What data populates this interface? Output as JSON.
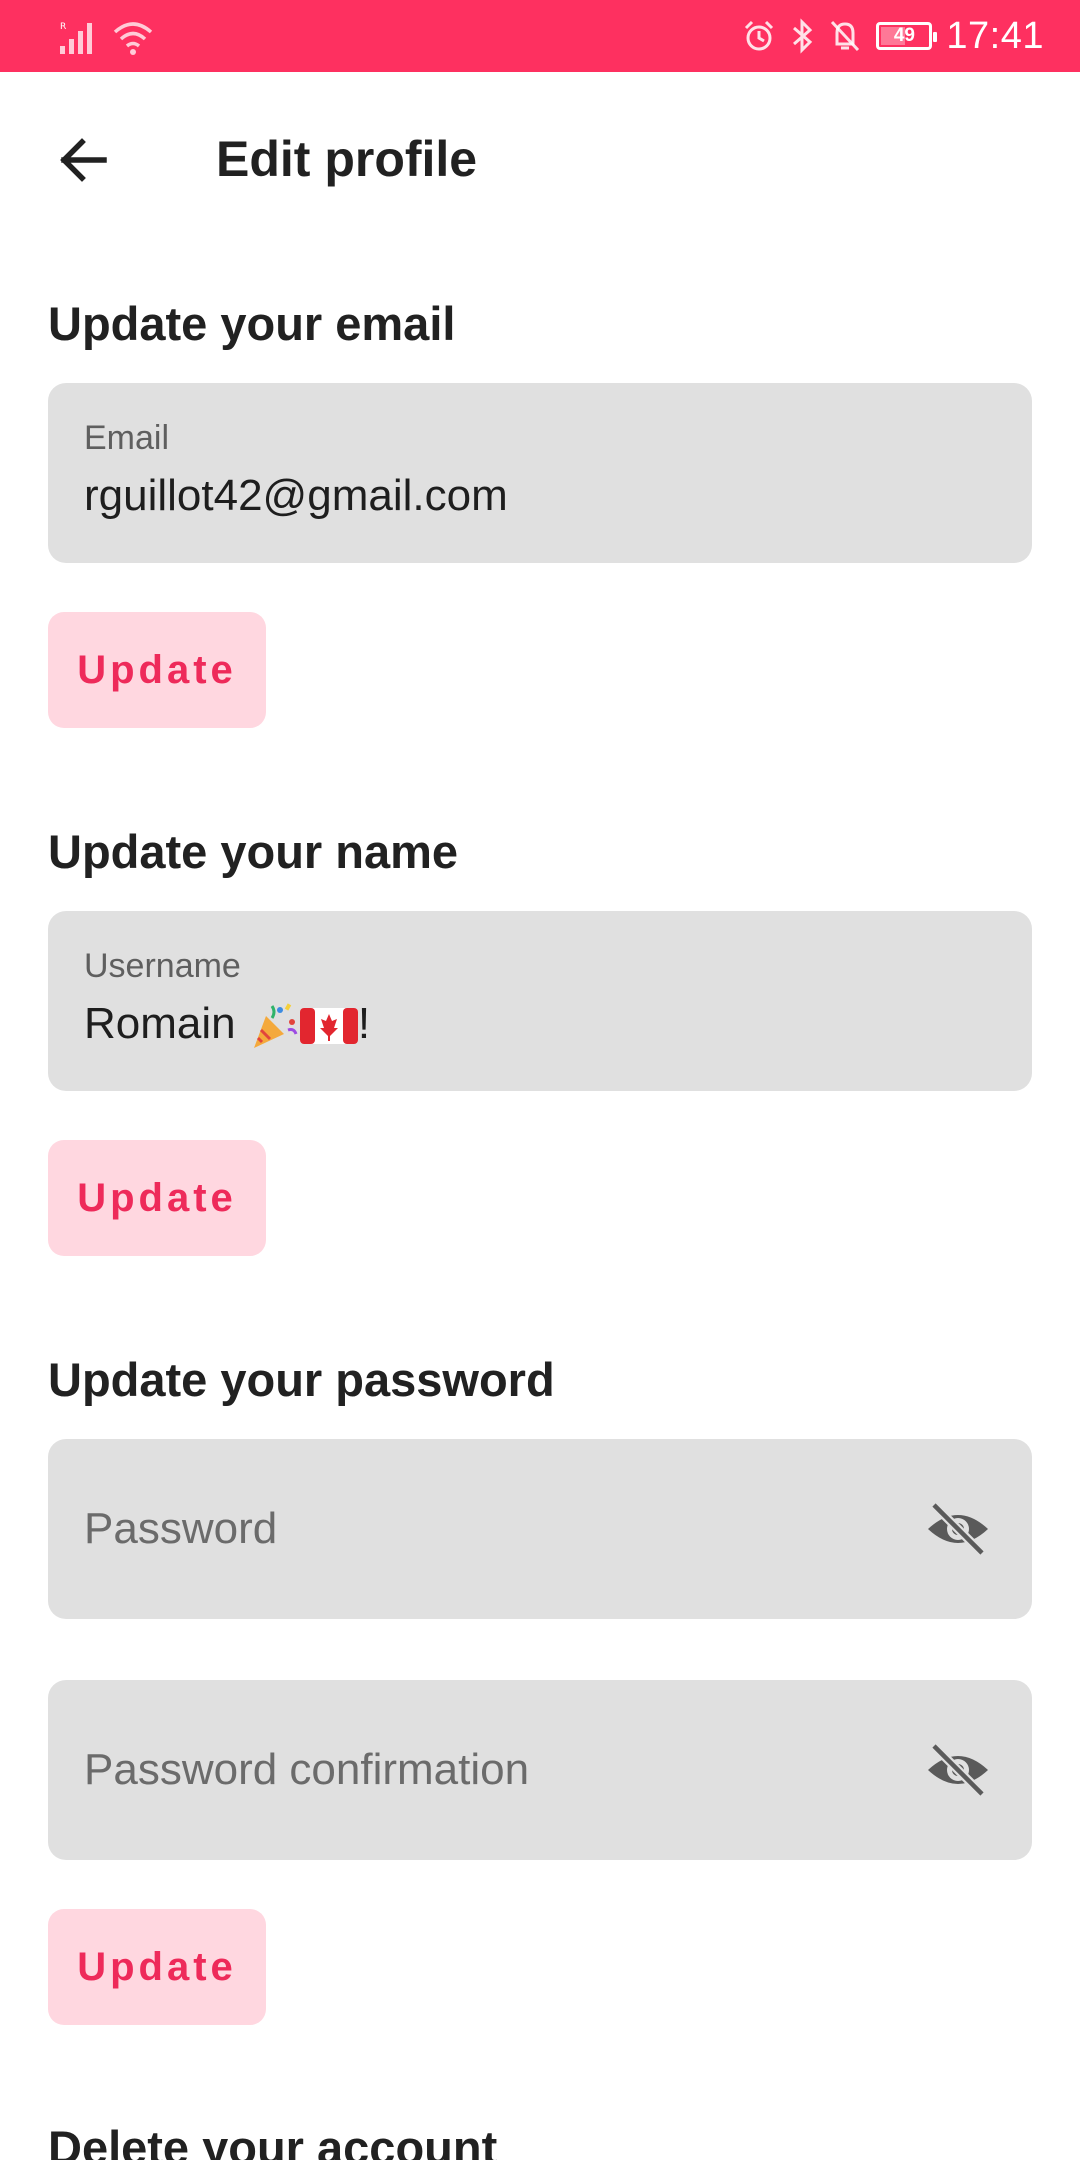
{
  "status_bar": {
    "time": "17:41",
    "battery_level": "49",
    "icons": [
      "signal-icon",
      "wifi-icon",
      "alarm-icon",
      "bluetooth-icon",
      "bell-off-icon",
      "battery-icon"
    ],
    "color": "#fe3060"
  },
  "header": {
    "title": "Edit profile",
    "back_icon": "arrow-left-icon"
  },
  "email_section": {
    "heading": "Update your email",
    "field_label": "Email",
    "field_value": "rguillot42@gmail.com",
    "button_label": "Update"
  },
  "name_section": {
    "heading": "Update your name",
    "field_label": "Username",
    "field_value_text": "Romain ",
    "field_value_suffix": "!",
    "field_value_emojis": [
      "party-popper-emoji",
      "canada-flag-emoji"
    ],
    "button_label": "Update"
  },
  "password_section": {
    "heading": "Update your password",
    "password_placeholder": "Password",
    "confirmation_placeholder": "Password confirmation",
    "visibility_icon": "eye-off-icon",
    "button_label": "Update"
  },
  "delete_section": {
    "heading": "Delete your account"
  },
  "colors": {
    "accent": "#ee2a5a",
    "button_bg": "#ffd7e0",
    "field_bg": "#e0e0e0"
  }
}
